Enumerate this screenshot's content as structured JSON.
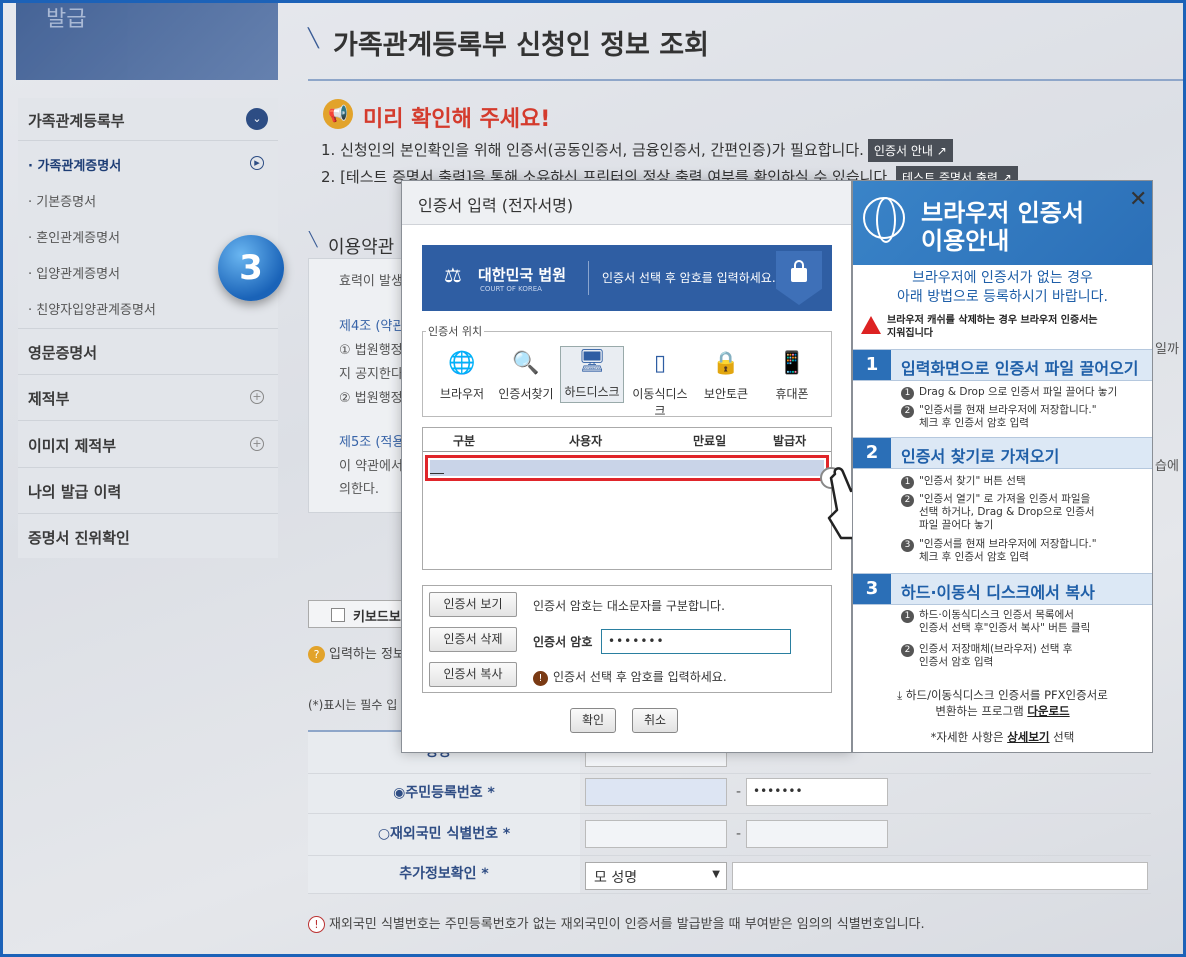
{
  "logo": {
    "text": "발급"
  },
  "sidebar": {
    "section_label": "가족관계등록부",
    "sub_items": [
      {
        "label": "· 가족관계증명서",
        "active": true
      },
      {
        "label": "· 기본증명서"
      },
      {
        "label": "· 혼인관계증명서"
      },
      {
        "label": "· 입양관계증명서"
      },
      {
        "label": "· 친양자입양관계증명서"
      }
    ],
    "items": [
      {
        "label": "영문증명서"
      },
      {
        "label": "제적부"
      },
      {
        "label": "이미지 제적부"
      },
      {
        "label": "나의 발급 이력"
      },
      {
        "label": "증명서 진위확인"
      }
    ]
  },
  "page": {
    "title": "가족관계등록부 신청인 정보 조회"
  },
  "notice": {
    "title": "미리 확인해 주세요!",
    "line1": "1. 신청인의 본인확인을 위해 인증서(공동인증서, 금융인증서, 간편인증)가 필요합니다.",
    "line1_btn": "인증서 안내 ↗",
    "line2": "2. [테스트 증명서 출력]을 통해 소유하신 프린터의 정상 출력 여부를 확인하실 수 있습니다.",
    "line2_btn": "테스트 증명서 출력 ↗"
  },
  "terms": {
    "title": "이용약관",
    "lines": [
      "효력이 발생",
      "제4조 (약관",
      "① 법원행정",
      "지 공지한다",
      "② 법원행정",
      "제5조 (적용",
      "이 약관에서",
      "의한다."
    ],
    "right_cut1": "일까",
    "right_cut2": "습에"
  },
  "step_badge": "3",
  "keyboard": {
    "label": "키보드보"
  },
  "hint": {
    "text": "입력하는 정보"
  },
  "required_note": "(*)표시는 필수 입",
  "form": {
    "name_label": "성명 *",
    "rrn_label": "주민등록번호 *",
    "rrn_masked": "•••••••",
    "foreign_label": "재외국민 식별번호 *",
    "extra_label": "추가정보확인 *",
    "extra_select": "모 성명",
    "dash": "-"
  },
  "footnote": "재외국민 식별번호는 주민등록번호가 없는 재외국민이 인증서를 발급받을 때 부여받은 임의의 식별번호입니다.",
  "modal": {
    "title": "인증서 입력 (전자서명)",
    "banner_title": "대한민국 법원",
    "banner_sub": "COURT OF KOREA",
    "banner_text": "인증서 선택 후 암호를 입력하세요.",
    "location_legend": "인증서 위치",
    "locations": [
      {
        "label": "브라우저",
        "icon": "globe-icon"
      },
      {
        "label": "인증서찾기",
        "icon": "cert-search-icon"
      },
      {
        "label": "하드디스크",
        "icon": "monitor-icon",
        "selected": true
      },
      {
        "label": "이동식디스크",
        "icon": "usb-icon"
      },
      {
        "label": "보안토큰",
        "icon": "token-icon"
      },
      {
        "label": "휴대폰",
        "icon": "phone-icon"
      }
    ],
    "columns": [
      "구분",
      "사용자",
      "만료일",
      "발급자"
    ],
    "view_btn": "인증서 보기",
    "delete_btn": "인증서 삭제",
    "copy_btn": "인증서 복사",
    "case_note": "인증서 암호는 대소문자를 구분합니다.",
    "pw_label": "인증서 암호",
    "pw_value": "•••••••",
    "warn_note": "인증서 선택 후 암호를 입력하세요.",
    "ok_btn": "확인",
    "cancel_btn": "취소"
  },
  "guide": {
    "title_line1": "브라우저 인증서",
    "title_line2": "이용안내",
    "sub_line1": "브라우저에 인증서가 없는 경우",
    "sub_line2": "아래 방법으로 등록하시기 바랍니다.",
    "warn_line1": "브라우저 캐쉬를 삭제하는 경우 브라우저 인증서는",
    "warn_line2": "지워집니다",
    "sections": [
      {
        "num": "1",
        "label": "입력화면으로 인증서 파일 끌어오기"
      },
      {
        "num": "2",
        "label": "인증서 찾기로 가져오기"
      },
      {
        "num": "3",
        "label": "하드·이동식 디스크에서 복사"
      }
    ],
    "s1_i1": "Drag & Drop 으로 인증서 파일 끌어다 놓기",
    "s1_i2a": "\"인증서를 현재 브라우저에 저장합니다.\"",
    "s1_i2b": "체크 후 인증서 암호 입력",
    "s2_i1": "\"인증서 찾기\" 버튼 선택",
    "s2_i2a": "\"인증서 열기\" 로 가져올 인증서 파일을",
    "s2_i2b": "선택 하거나, Drag & Drop으로 인증서",
    "s2_i2c": "파일 끌어다 놓기",
    "s2_i3a": "\"인증서를 현재 브라우저에 저장합니다.\"",
    "s2_i3b": "체크 후 인증서 암호 입력",
    "s3_i1a": "하드·이동식디스크 인증서 목록에서",
    "s3_i1b": "인증서 선택 후\"인증서 복사\" 버튼 클릭",
    "s3_i2a": "인증서 저장매체(브라우저) 선택 후",
    "s3_i2b": "인증서 암호 입력",
    "foot1": "하드/이동식디스크 인증서를 PFX인증서로",
    "foot2_pre": "변환하는 프로그램 ",
    "foot2_link": "다운로드",
    "foot3_pre": "*자세한 사항은 ",
    "foot3_link": "상세보기",
    "foot3_post": " 선택"
  }
}
